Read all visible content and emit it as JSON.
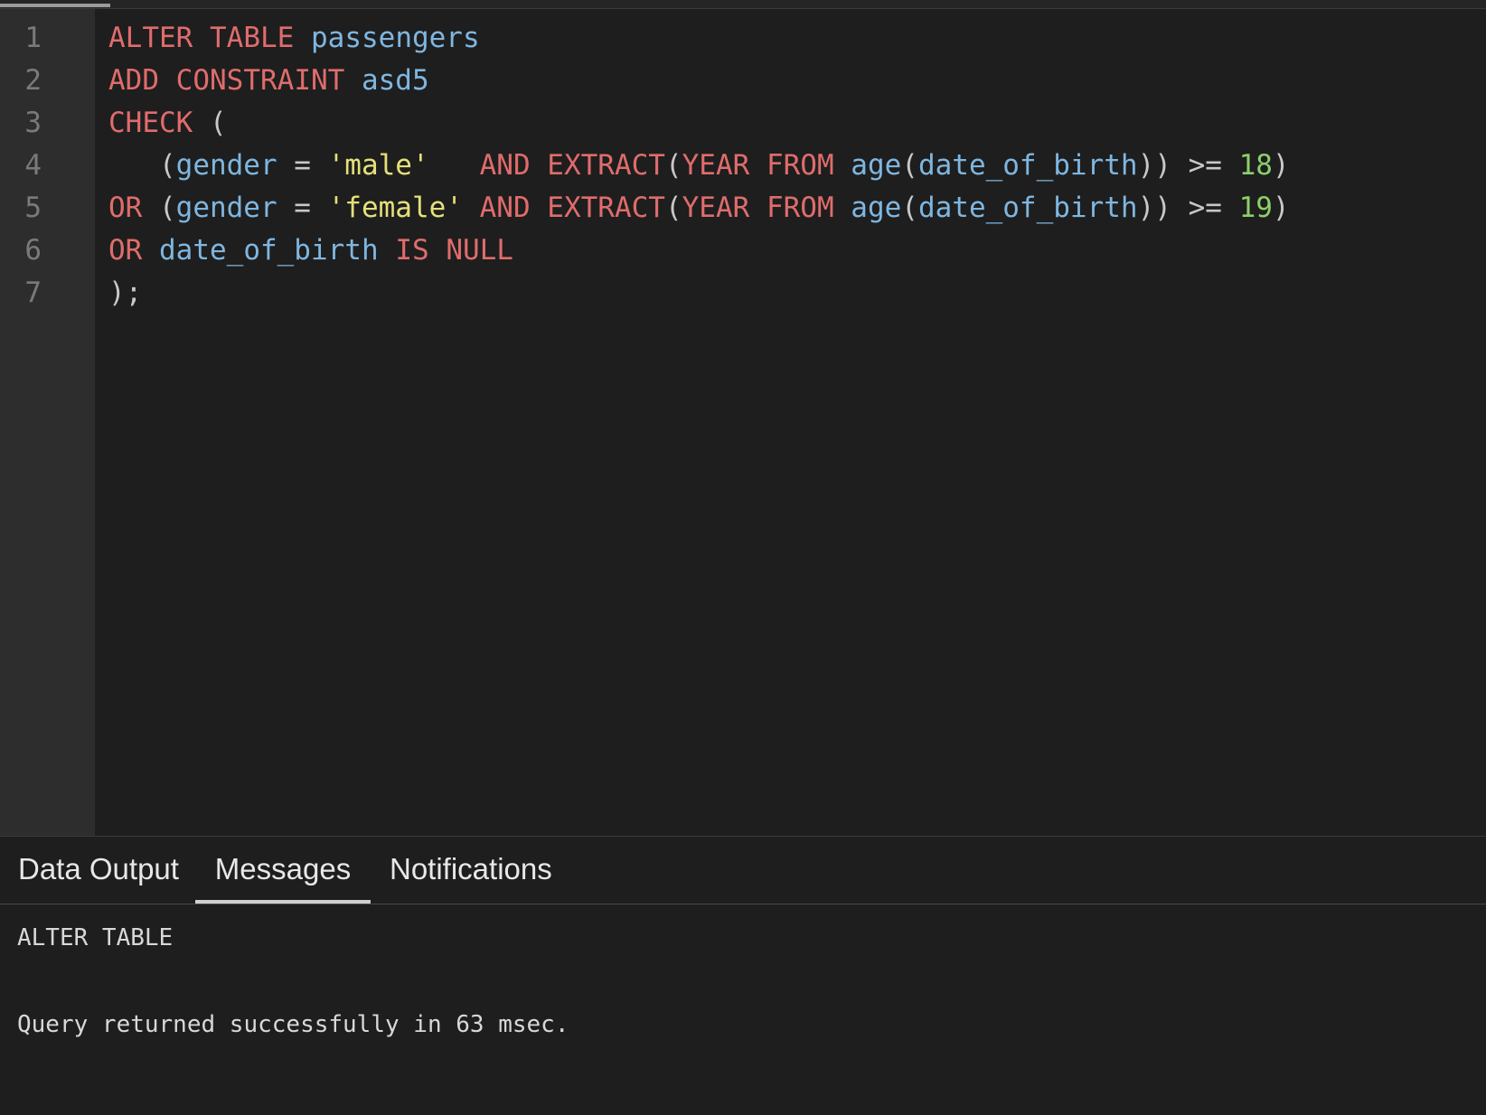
{
  "editor": {
    "line_numbers": [
      "1",
      "2",
      "3",
      "4",
      "5",
      "6",
      "7"
    ],
    "lines": [
      [
        {
          "t": "ALTER",
          "c": "kw"
        },
        {
          "t": " ",
          "c": "pun"
        },
        {
          "t": "TABLE",
          "c": "kw"
        },
        {
          "t": " ",
          "c": "pun"
        },
        {
          "t": "passengers",
          "c": "id"
        }
      ],
      [
        {
          "t": "ADD",
          "c": "kw"
        },
        {
          "t": " ",
          "c": "pun"
        },
        {
          "t": "CONSTRAINT",
          "c": "kw"
        },
        {
          "t": " ",
          "c": "pun"
        },
        {
          "t": "asd5",
          "c": "id"
        }
      ],
      [
        {
          "t": "CHECK",
          "c": "kw"
        },
        {
          "t": " (",
          "c": "pun"
        }
      ],
      [
        {
          "t": "   (",
          "c": "pun"
        },
        {
          "t": "gender",
          "c": "id"
        },
        {
          "t": " = ",
          "c": "pun"
        },
        {
          "t": "'male'",
          "c": "str"
        },
        {
          "t": "   ",
          "c": "pun"
        },
        {
          "t": "AND",
          "c": "kw"
        },
        {
          "t": " ",
          "c": "pun"
        },
        {
          "t": "EXTRACT",
          "c": "kw"
        },
        {
          "t": "(",
          "c": "pun"
        },
        {
          "t": "YEAR",
          "c": "kw"
        },
        {
          "t": " ",
          "c": "pun"
        },
        {
          "t": "FROM",
          "c": "kw"
        },
        {
          "t": " ",
          "c": "pun"
        },
        {
          "t": "age",
          "c": "id"
        },
        {
          "t": "(",
          "c": "pun"
        },
        {
          "t": "date_of_birth",
          "c": "id"
        },
        {
          "t": ")) >= ",
          "c": "pun"
        },
        {
          "t": "18",
          "c": "num"
        },
        {
          "t": ")",
          "c": "pun"
        }
      ],
      [
        {
          "t": "OR",
          "c": "kw"
        },
        {
          "t": " (",
          "c": "pun"
        },
        {
          "t": "gender",
          "c": "id"
        },
        {
          "t": " = ",
          "c": "pun"
        },
        {
          "t": "'female'",
          "c": "str"
        },
        {
          "t": " ",
          "c": "pun"
        },
        {
          "t": "AND",
          "c": "kw"
        },
        {
          "t": " ",
          "c": "pun"
        },
        {
          "t": "EXTRACT",
          "c": "kw"
        },
        {
          "t": "(",
          "c": "pun"
        },
        {
          "t": "YEAR",
          "c": "kw"
        },
        {
          "t": " ",
          "c": "pun"
        },
        {
          "t": "FROM",
          "c": "kw"
        },
        {
          "t": " ",
          "c": "pun"
        },
        {
          "t": "age",
          "c": "id"
        },
        {
          "t": "(",
          "c": "pun"
        },
        {
          "t": "date_of_birth",
          "c": "id"
        },
        {
          "t": ")) >= ",
          "c": "pun"
        },
        {
          "t": "19",
          "c": "num"
        },
        {
          "t": ")",
          "c": "pun"
        }
      ],
      [
        {
          "t": "OR",
          "c": "kw"
        },
        {
          "t": " ",
          "c": "pun"
        },
        {
          "t": "date_of_birth",
          "c": "id"
        },
        {
          "t": " ",
          "c": "pun"
        },
        {
          "t": "IS",
          "c": "kw"
        },
        {
          "t": " ",
          "c": "pun"
        },
        {
          "t": "NULL",
          "c": "kw"
        }
      ],
      [
        {
          "t": ");",
          "c": "pun"
        }
      ]
    ]
  },
  "tabs": {
    "data_output": "Data Output",
    "messages": "Messages",
    "notifications": "Notifications",
    "active": "messages"
  },
  "messages": {
    "line1": "ALTER TABLE",
    "line2": "Query returned successfully in 63 msec."
  },
  "colors": {
    "keyword": "#e06c6c",
    "identifier": "#7fb6e0",
    "string": "#e5e079",
    "number": "#8ccf6b",
    "background": "#1e1e1e",
    "gutter": "#2d2d2d"
  }
}
